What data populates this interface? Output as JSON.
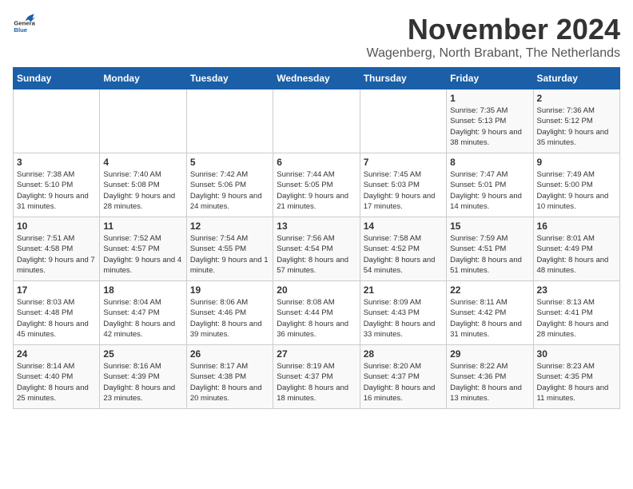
{
  "logo": {
    "line1": "General",
    "line2": "Blue"
  },
  "title": "November 2024",
  "location": "Wagenberg, North Brabant, The Netherlands",
  "days_of_week": [
    "Sunday",
    "Monday",
    "Tuesday",
    "Wednesday",
    "Thursday",
    "Friday",
    "Saturday"
  ],
  "weeks": [
    [
      {
        "day": "",
        "info": ""
      },
      {
        "day": "",
        "info": ""
      },
      {
        "day": "",
        "info": ""
      },
      {
        "day": "",
        "info": ""
      },
      {
        "day": "",
        "info": ""
      },
      {
        "day": "1",
        "info": "Sunrise: 7:35 AM\nSunset: 5:13 PM\nDaylight: 9 hours and 38 minutes."
      },
      {
        "day": "2",
        "info": "Sunrise: 7:36 AM\nSunset: 5:12 PM\nDaylight: 9 hours and 35 minutes."
      }
    ],
    [
      {
        "day": "3",
        "info": "Sunrise: 7:38 AM\nSunset: 5:10 PM\nDaylight: 9 hours and 31 minutes."
      },
      {
        "day": "4",
        "info": "Sunrise: 7:40 AM\nSunset: 5:08 PM\nDaylight: 9 hours and 28 minutes."
      },
      {
        "day": "5",
        "info": "Sunrise: 7:42 AM\nSunset: 5:06 PM\nDaylight: 9 hours and 24 minutes."
      },
      {
        "day": "6",
        "info": "Sunrise: 7:44 AM\nSunset: 5:05 PM\nDaylight: 9 hours and 21 minutes."
      },
      {
        "day": "7",
        "info": "Sunrise: 7:45 AM\nSunset: 5:03 PM\nDaylight: 9 hours and 17 minutes."
      },
      {
        "day": "8",
        "info": "Sunrise: 7:47 AM\nSunset: 5:01 PM\nDaylight: 9 hours and 14 minutes."
      },
      {
        "day": "9",
        "info": "Sunrise: 7:49 AM\nSunset: 5:00 PM\nDaylight: 9 hours and 10 minutes."
      }
    ],
    [
      {
        "day": "10",
        "info": "Sunrise: 7:51 AM\nSunset: 4:58 PM\nDaylight: 9 hours and 7 minutes."
      },
      {
        "day": "11",
        "info": "Sunrise: 7:52 AM\nSunset: 4:57 PM\nDaylight: 9 hours and 4 minutes."
      },
      {
        "day": "12",
        "info": "Sunrise: 7:54 AM\nSunset: 4:55 PM\nDaylight: 9 hours and 1 minute."
      },
      {
        "day": "13",
        "info": "Sunrise: 7:56 AM\nSunset: 4:54 PM\nDaylight: 8 hours and 57 minutes."
      },
      {
        "day": "14",
        "info": "Sunrise: 7:58 AM\nSunset: 4:52 PM\nDaylight: 8 hours and 54 minutes."
      },
      {
        "day": "15",
        "info": "Sunrise: 7:59 AM\nSunset: 4:51 PM\nDaylight: 8 hours and 51 minutes."
      },
      {
        "day": "16",
        "info": "Sunrise: 8:01 AM\nSunset: 4:49 PM\nDaylight: 8 hours and 48 minutes."
      }
    ],
    [
      {
        "day": "17",
        "info": "Sunrise: 8:03 AM\nSunset: 4:48 PM\nDaylight: 8 hours and 45 minutes."
      },
      {
        "day": "18",
        "info": "Sunrise: 8:04 AM\nSunset: 4:47 PM\nDaylight: 8 hours and 42 minutes."
      },
      {
        "day": "19",
        "info": "Sunrise: 8:06 AM\nSunset: 4:46 PM\nDaylight: 8 hours and 39 minutes."
      },
      {
        "day": "20",
        "info": "Sunrise: 8:08 AM\nSunset: 4:44 PM\nDaylight: 8 hours and 36 minutes."
      },
      {
        "day": "21",
        "info": "Sunrise: 8:09 AM\nSunset: 4:43 PM\nDaylight: 8 hours and 33 minutes."
      },
      {
        "day": "22",
        "info": "Sunrise: 8:11 AM\nSunset: 4:42 PM\nDaylight: 8 hours and 31 minutes."
      },
      {
        "day": "23",
        "info": "Sunrise: 8:13 AM\nSunset: 4:41 PM\nDaylight: 8 hours and 28 minutes."
      }
    ],
    [
      {
        "day": "24",
        "info": "Sunrise: 8:14 AM\nSunset: 4:40 PM\nDaylight: 8 hours and 25 minutes."
      },
      {
        "day": "25",
        "info": "Sunrise: 8:16 AM\nSunset: 4:39 PM\nDaylight: 8 hours and 23 minutes."
      },
      {
        "day": "26",
        "info": "Sunrise: 8:17 AM\nSunset: 4:38 PM\nDaylight: 8 hours and 20 minutes."
      },
      {
        "day": "27",
        "info": "Sunrise: 8:19 AM\nSunset: 4:37 PM\nDaylight: 8 hours and 18 minutes."
      },
      {
        "day": "28",
        "info": "Sunrise: 8:20 AM\nSunset: 4:37 PM\nDaylight: 8 hours and 16 minutes."
      },
      {
        "day": "29",
        "info": "Sunrise: 8:22 AM\nSunset: 4:36 PM\nDaylight: 8 hours and 13 minutes."
      },
      {
        "day": "30",
        "info": "Sunrise: 8:23 AM\nSunset: 4:35 PM\nDaylight: 8 hours and 11 minutes."
      }
    ]
  ]
}
